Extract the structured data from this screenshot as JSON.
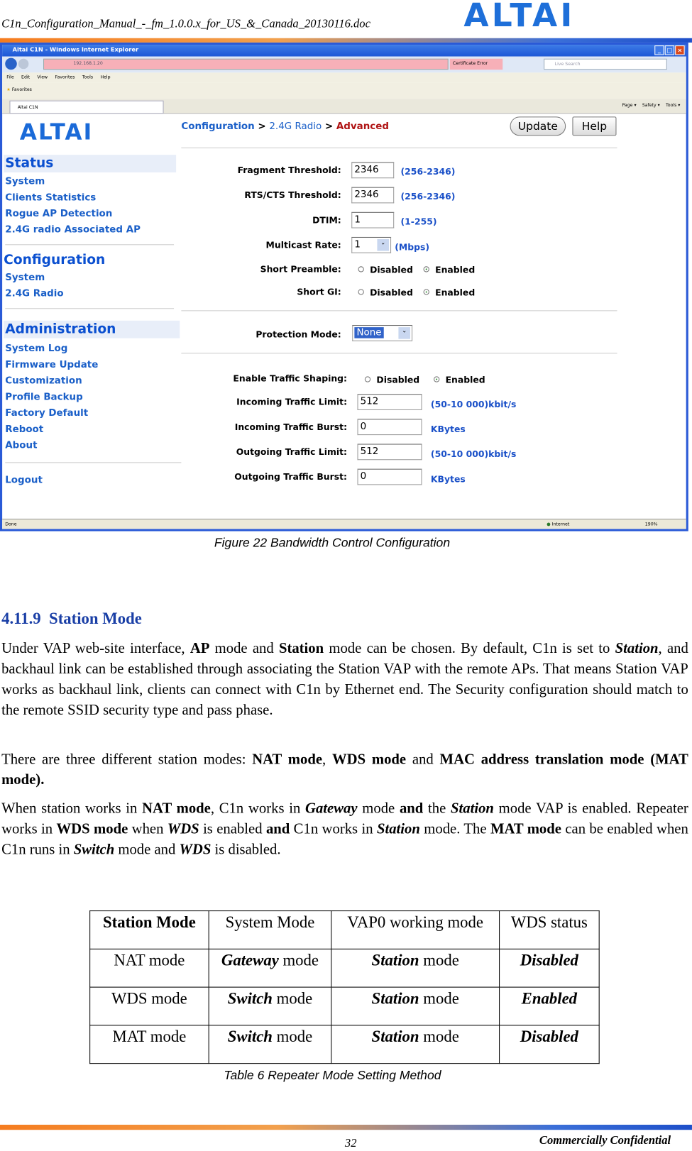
{
  "doc_header": {
    "title": "C1n_Configuration_Manual_-_fm_1.0.0.x_for_US_&_Canada_20130116.doc",
    "logo": "ALTAI"
  },
  "browser": {
    "title": "Altai C1N - Windows Internet Explorer",
    "url": "192.168.1.20",
    "cert_error": "Certificate Error",
    "search_placeholder": "Live Search",
    "menu": [
      "File",
      "Edit",
      "View",
      "Favorites",
      "Tools",
      "Help"
    ],
    "favorites": "Favorites",
    "tab": "Altai C1N",
    "cmd": [
      "Page ▾",
      "Safety ▾",
      "Tools ▾"
    ],
    "status": "Done",
    "zone": "Internet",
    "zoom": "190%"
  },
  "app": {
    "logo": "ALTAI",
    "breadcrumb": {
      "a": "Configuration",
      "b": "2.4G Radio",
      "c": "Advanced",
      "sep": ">"
    },
    "update": "Update",
    "help": "Help",
    "nav": {
      "status": "Status",
      "status_items": [
        "System",
        "Clients Statistics",
        "Rogue AP Detection",
        "2.4G radio Associated AP"
      ],
      "config": "Configuration",
      "config_items": [
        "System",
        "2.4G Radio"
      ],
      "admin": "Administration",
      "admin_items": [
        "System Log",
        "Firmware Update",
        "Customization",
        "Profile Backup",
        "Factory Default",
        "Reboot",
        "About"
      ],
      "logout": "Logout"
    },
    "form": {
      "frag_label": "Fragment Threshold:",
      "frag": "2346",
      "frag_range": "(256-2346)",
      "rts_label": "RTS/CTS Threshold:",
      "rts": "2346",
      "rts_range": "(256-2346)",
      "dtim_label": "DTIM:",
      "dtim": "1",
      "dtim_range": "(1-255)",
      "mcast_label": "Multicast Rate:",
      "mcast": "1",
      "mcast_unit": "(Mbps)",
      "preamble_label": "Short Preamble:",
      "gi_label": "Short GI:",
      "disabled": "Disabled",
      "enabled": "Enabled",
      "prot_label": "Protection Mode:",
      "prot": "None",
      "shaping_label": "Enable Traffic Shaping:",
      "in_limit_label": "Incoming Traffic Limit:",
      "in_limit": "512",
      "in_limit_unit": "(50-10 000)kbit/s",
      "in_burst_label": "Incoming Traffic Burst:",
      "in_burst": "0",
      "in_burst_unit": "KBytes",
      "out_limit_label": "Outgoing Traffic Limit:",
      "out_limit": "512",
      "out_limit_unit": "(50-10 000)kbit/s",
      "out_burst_label": "Outgoing Traffic Burst:",
      "out_burst": "0",
      "out_burst_unit": "KBytes"
    }
  },
  "figure_caption": "Figure 22    Bandwidth Control Configuration",
  "section": {
    "number": "4.11.9",
    "title": "Station Mode"
  },
  "table": {
    "headers": [
      "Station Mode",
      "System Mode",
      "VAP0 working mode",
      "WDS status"
    ],
    "rows": [
      [
        "NAT mode",
        "Gateway",
        "mode",
        "Station",
        "mode",
        "Disabled"
      ],
      [
        "WDS mode",
        "Switch",
        "mode",
        "Station",
        "mode",
        "Enabled"
      ],
      [
        "MAT mode",
        "Switch",
        "mode",
        "Station",
        "mode",
        "Disabled"
      ]
    ]
  },
  "table_caption": "Table 6    Repeater Mode Setting Method",
  "footer": {
    "page": "32",
    "confidential": "Commercially Confidential"
  }
}
